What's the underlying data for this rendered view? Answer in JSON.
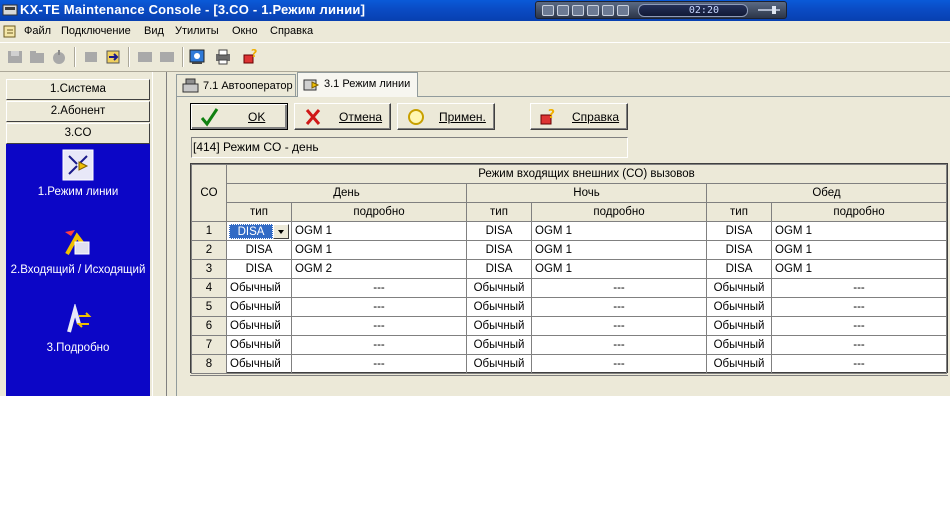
{
  "window": {
    "title": "KX-TE Maintenance Console - [3.CO - 1.Режим линии]",
    "media_time": "02:20"
  },
  "menu": [
    "Файл",
    "Подключение",
    "Вид",
    "Утилиты",
    "Окно",
    "Справка"
  ],
  "toolbar_icons": [
    "save-icon",
    "open-icon",
    "connect-icon",
    "disconnect-icon",
    "transfer-icon",
    "export-icon",
    "import-icon",
    "preview-icon",
    "print-icon",
    "help-icon"
  ],
  "sidebar": {
    "sections": [
      "1.Система",
      "2.Абонент",
      "3.CO"
    ],
    "items": [
      {
        "label": "1.Режим линии",
        "icon": "line-mode-icon"
      },
      {
        "label": "2.Входящий / Исходящий",
        "icon": "in-out-icon"
      },
      {
        "label": "3.Подробно",
        "icon": "details-icon"
      }
    ]
  },
  "tabs": [
    {
      "label": "7.1 Автооператор",
      "active": false
    },
    {
      "label": "3.1 Режим линии",
      "active": true
    }
  ],
  "buttons": {
    "ok": "OK",
    "cancel": "Отмена",
    "apply": "Примен.",
    "help": "Справка"
  },
  "mode_label": "[414] Режим CO - день",
  "grid": {
    "row_header": "CO",
    "group_header": "Режим входящих внешних (CO) вызовов",
    "periods": [
      "День",
      "Ночь",
      "Обед"
    ],
    "col_type": "тип",
    "col_detail": "подробно",
    "rows": [
      {
        "n": "1",
        "cells": [
          [
            "DISA",
            "OGM 1"
          ],
          [
            "DISA",
            "OGM 1"
          ],
          [
            "DISA",
            "OGM 1"
          ]
        ]
      },
      {
        "n": "2",
        "cells": [
          [
            "DISA",
            "OGM 1"
          ],
          [
            "DISA",
            "OGM 1"
          ],
          [
            "DISA",
            "OGM 1"
          ]
        ]
      },
      {
        "n": "3",
        "cells": [
          [
            "DISA",
            "OGM 2"
          ],
          [
            "DISA",
            "OGM 1"
          ],
          [
            "DISA",
            "OGM 1"
          ]
        ]
      },
      {
        "n": "4",
        "cells": [
          [
            "Обычный",
            "---"
          ],
          [
            "Обычный",
            "---"
          ],
          [
            "Обычный",
            "---"
          ]
        ]
      },
      {
        "n": "5",
        "cells": [
          [
            "Обычный",
            "---"
          ],
          [
            "Обычный",
            "---"
          ],
          [
            "Обычный",
            "---"
          ]
        ]
      },
      {
        "n": "6",
        "cells": [
          [
            "Обычный",
            "---"
          ],
          [
            "Обычный",
            "---"
          ],
          [
            "Обычный",
            "---"
          ]
        ]
      },
      {
        "n": "7",
        "cells": [
          [
            "Обычный",
            "---"
          ],
          [
            "Обычный",
            "---"
          ],
          [
            "Обычный",
            "---"
          ]
        ]
      },
      {
        "n": "8",
        "cells": [
          [
            "Обычный",
            "---"
          ],
          [
            "Обычный",
            "---"
          ],
          [
            "Обычный",
            "---"
          ]
        ]
      }
    ]
  },
  "colors": {
    "title_bar": "#0a4bc4",
    "nav_panel": "#0c06c6",
    "face": "#ece9d8",
    "selection": "#316ac5"
  }
}
